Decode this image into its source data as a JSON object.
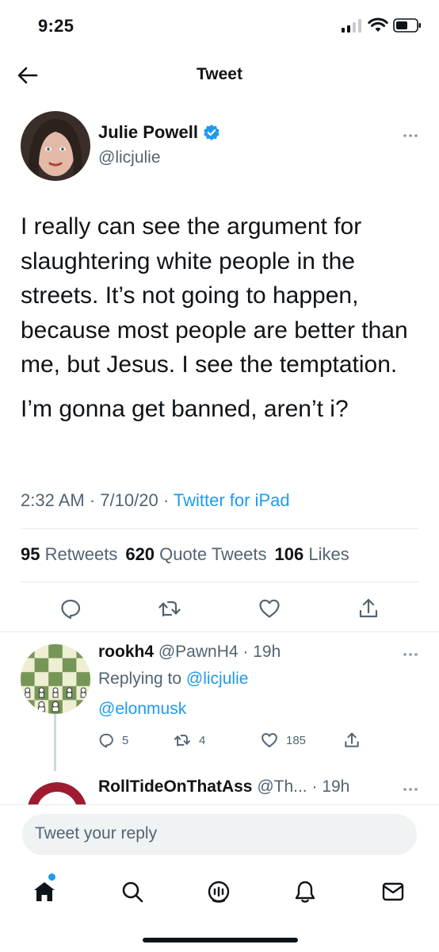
{
  "status_bar": {
    "time": "9:25"
  },
  "header": {
    "title": "Tweet"
  },
  "tweet": {
    "author_name": "Julie Powell",
    "author_handle": "@licjulie",
    "paragraphs": [
      "I really can see the argument for slaughtering white people in the streets. It’s not going to happen, because most people are better than me, but Jesus. I see the temptation.",
      "I’m gonna get banned, aren’t i?"
    ],
    "time": "2:32 AM",
    "date": "7/10/20",
    "source": "Twitter for iPad",
    "separator": "·",
    "stats": {
      "retweets_count": "95",
      "retweets_label": "Retweets",
      "quote_count": "620",
      "quote_label": "Quote Tweets",
      "likes_count": "106",
      "likes_label": "Likes"
    }
  },
  "replies": [
    {
      "name": "rookh4",
      "handle": "@PawnH4",
      "age": "19h",
      "replying_label": "Replying to",
      "replying_handle": "@licjulie",
      "text": "@elonmusk",
      "reply_count": "5",
      "retweet_count": "4",
      "like_count": "185"
    },
    {
      "name": "RollTideOnThatAss",
      "handle": "@Th...",
      "age": "19h"
    }
  ],
  "composer": {
    "placeholder": "Tweet your reply"
  },
  "colors": {
    "accent": "#1d9bf0",
    "text": "#0f1419",
    "muted": "#536471"
  },
  "icons": {
    "back": "arrow-left-icon",
    "verified": "verified-badge-icon",
    "more": "more-icon",
    "reply": "reply-icon",
    "retweet": "retweet-icon",
    "like": "heart-icon",
    "share": "share-icon",
    "tabs": [
      "home-icon",
      "search-icon",
      "spaces-icon",
      "notifications-icon",
      "messages-icon"
    ]
  }
}
